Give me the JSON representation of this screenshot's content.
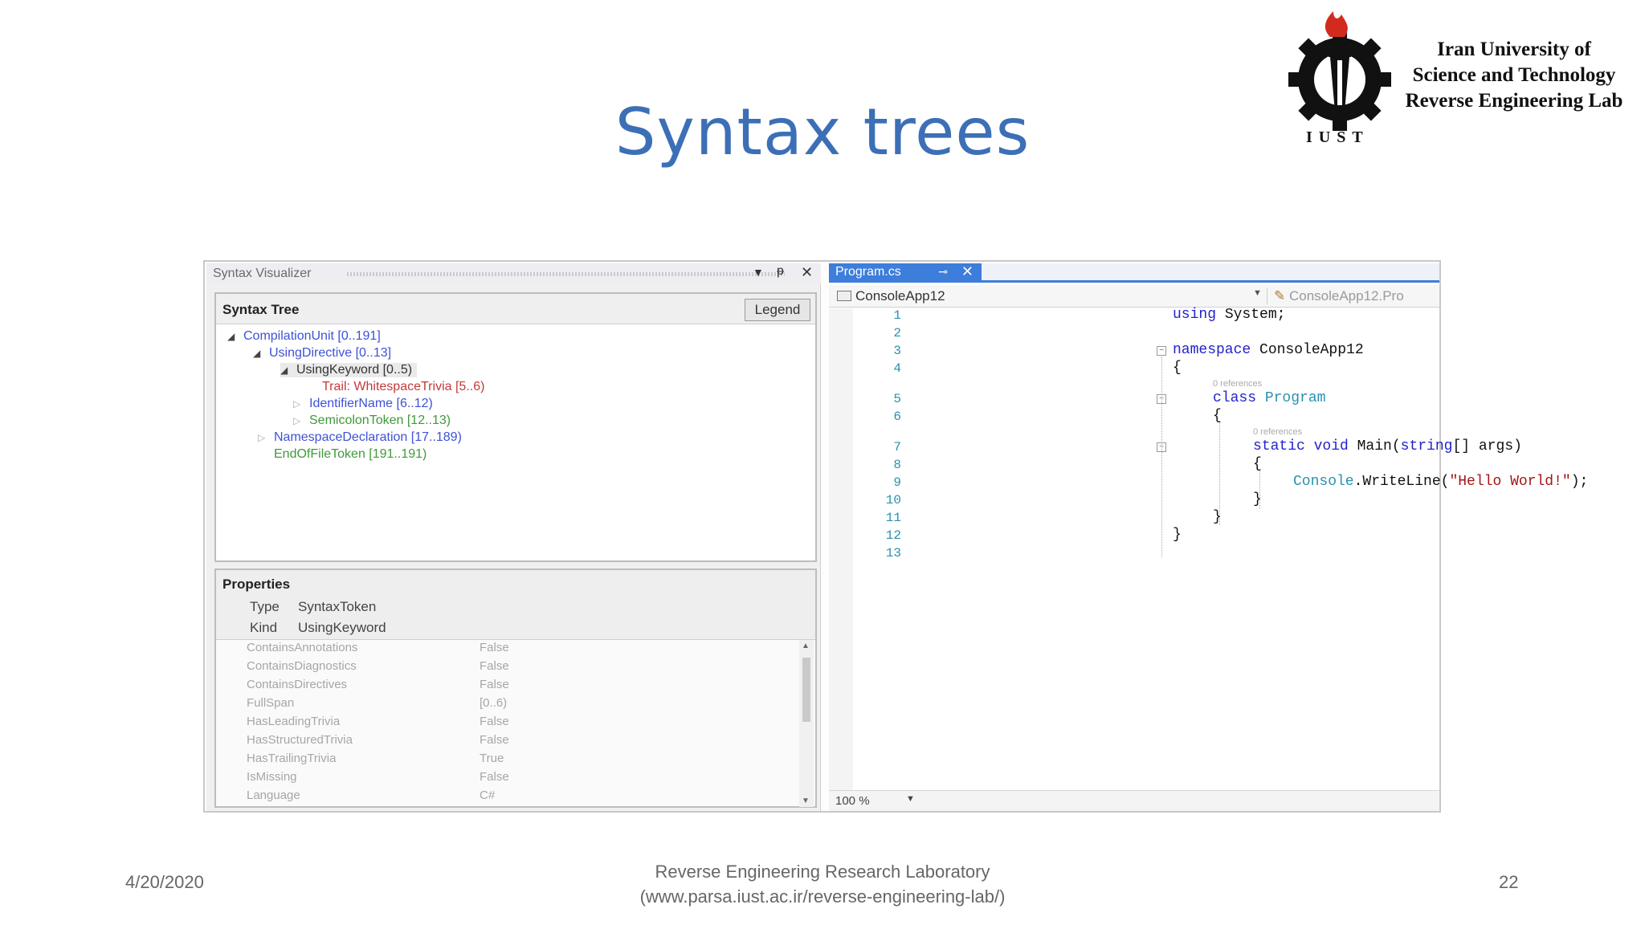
{
  "slide": {
    "title": "Syntax trees",
    "date": "4/20/2020",
    "footer_line1": "Reverse Engineering Research Laboratory",
    "footer_line2": "(www.parsa.iust.ac.ir/reverse-engineering-lab/)",
    "page_number": "22"
  },
  "logo": {
    "line1": "Iran University of",
    "line2": "Science and Technology",
    "line3": "Reverse Engineering Lab",
    "abbr": "IUST",
    "icon": "torch-gear-icon"
  },
  "syntax_visualizer": {
    "window_title": "Syntax Visualizer",
    "tree_header": "Syntax Tree",
    "legend_button": "Legend",
    "tree": [
      {
        "label": "CompilationUnit [0..191]",
        "expander": "◢",
        "color": "#3d52d6"
      },
      {
        "label": "UsingDirective [0..13]",
        "expander": "◢",
        "color": "#3d52d6"
      },
      {
        "label": "UsingKeyword [0..5)",
        "expander": "◢",
        "color": "#333333"
      },
      {
        "label": "Trail: WhitespaceTrivia [5..6)",
        "expander": "",
        "color": "#c43a3a"
      },
      {
        "label": "IdentifierName [6..12)",
        "expander": "▷",
        "color": "#3d52d6"
      },
      {
        "label": "SemicolonToken [12..13)",
        "expander": "▷",
        "color": "#3f9a3a"
      },
      {
        "label": "NamespaceDeclaration [17..189)",
        "expander": "▷",
        "color": "#3d52d6"
      },
      {
        "label": "EndOfFileToken [191..191)",
        "expander": "",
        "color": "#3f9a3a"
      }
    ],
    "properties_header": "Properties",
    "type_label": "Type",
    "type_value": "SyntaxToken",
    "kind_label": "Kind",
    "kind_value": "UsingKeyword",
    "property_rows": [
      {
        "name": "ContainsAnnotations",
        "value": "False"
      },
      {
        "name": "ContainsDiagnostics",
        "value": "False"
      },
      {
        "name": "ContainsDirectives",
        "value": "False"
      },
      {
        "name": "FullSpan",
        "value": "[0..6)"
      },
      {
        "name": "HasLeadingTrivia",
        "value": "False"
      },
      {
        "name": "HasStructuredTrivia",
        "value": "False"
      },
      {
        "name": "HasTrailingTrivia",
        "value": "True"
      },
      {
        "name": "IsMissing",
        "value": "False"
      },
      {
        "name": "Language",
        "value": "C#"
      }
    ]
  },
  "editor": {
    "tab_label": "Program.cs",
    "project_dropdown": "ConsoleApp12",
    "member_dropdown": "ConsoleApp12.Pro",
    "zoom": "100 %",
    "references_hint": "0 references",
    "line_numbers": [
      "1",
      "2",
      "3",
      "4",
      "5",
      "6",
      "7",
      "8",
      "9",
      "10",
      "11",
      "12",
      "13"
    ],
    "code": {
      "l1_kw": "using",
      "l1_rest": " System;",
      "l3_kw": "namespace",
      "l3_rest": " ConsoleApp12",
      "l4": "{",
      "l5_kw": "class",
      "l5_ty": " Program",
      "l6": "{",
      "l7_kw": "static void",
      "l7_mid": " Main(",
      "l7_kw2": "string",
      "l7_rest": "[] args)",
      "l8": "{",
      "l9_ty": "Console",
      "l9_mid": ".WriteLine(",
      "l9_st": "\"Hello World!\"",
      "l9_end": ");",
      "l10": "}",
      "l11": "}",
      "l12": "}"
    }
  }
}
